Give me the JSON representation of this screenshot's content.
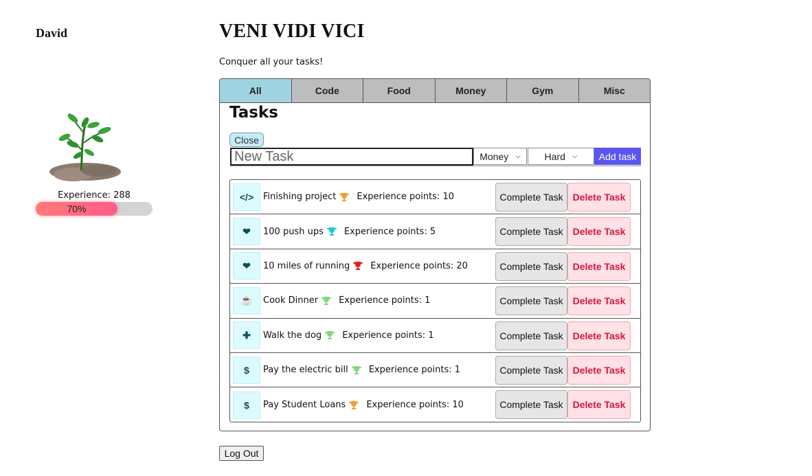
{
  "user": {
    "name": "David"
  },
  "experience": {
    "label": "Experience: 288",
    "progress_percent": 70,
    "progress_label": "70%"
  },
  "app": {
    "title": "VENI VIDI VICI",
    "tagline": "Conquer all your tasks!"
  },
  "tabs": [
    {
      "label": "All",
      "active": true
    },
    {
      "label": "Code",
      "active": false
    },
    {
      "label": "Food",
      "active": false
    },
    {
      "label": "Money",
      "active": false
    },
    {
      "label": "Gym",
      "active": false
    },
    {
      "label": "Misc",
      "active": false
    }
  ],
  "tasks_section": {
    "title": "Tasks",
    "close_label": "Close",
    "new_task_placeholder": "New Task",
    "category_selected": "Money",
    "difficulty_selected": "Hard",
    "add_label": "Add task"
  },
  "tasks": [
    {
      "icon": "code-icon",
      "name": "Finishing project",
      "trophy_color": "#f0a030",
      "xp_text": "Experience points: 10"
    },
    {
      "icon": "heart-icon",
      "name": "100 push ups",
      "trophy_color": "#20c8d8",
      "xp_text": "Experience points: 5"
    },
    {
      "icon": "heart-icon",
      "name": "10 miles of running",
      "trophy_color": "#e02020",
      "xp_text": "Experience points: 20"
    },
    {
      "icon": "coffee-icon",
      "name": "Cook Dinner",
      "trophy_color": "#80d880",
      "xp_text": "Experience points: 1"
    },
    {
      "icon": "plus-icon",
      "name": "Walk the dog",
      "trophy_color": "#80d880",
      "xp_text": "Experience points: 1"
    },
    {
      "icon": "dollar-icon",
      "name": "Pay the electric bill",
      "trophy_color": "#80d880",
      "xp_text": "Experience points: 1"
    },
    {
      "icon": "dollar-icon",
      "name": "Pay Student Loans",
      "trophy_color": "#f0a030",
      "xp_text": "Experience points: 10"
    }
  ],
  "task_actions": {
    "complete_label": "Complete Task",
    "delete_label": "Delete Task"
  },
  "logout_label": "Log Out"
}
